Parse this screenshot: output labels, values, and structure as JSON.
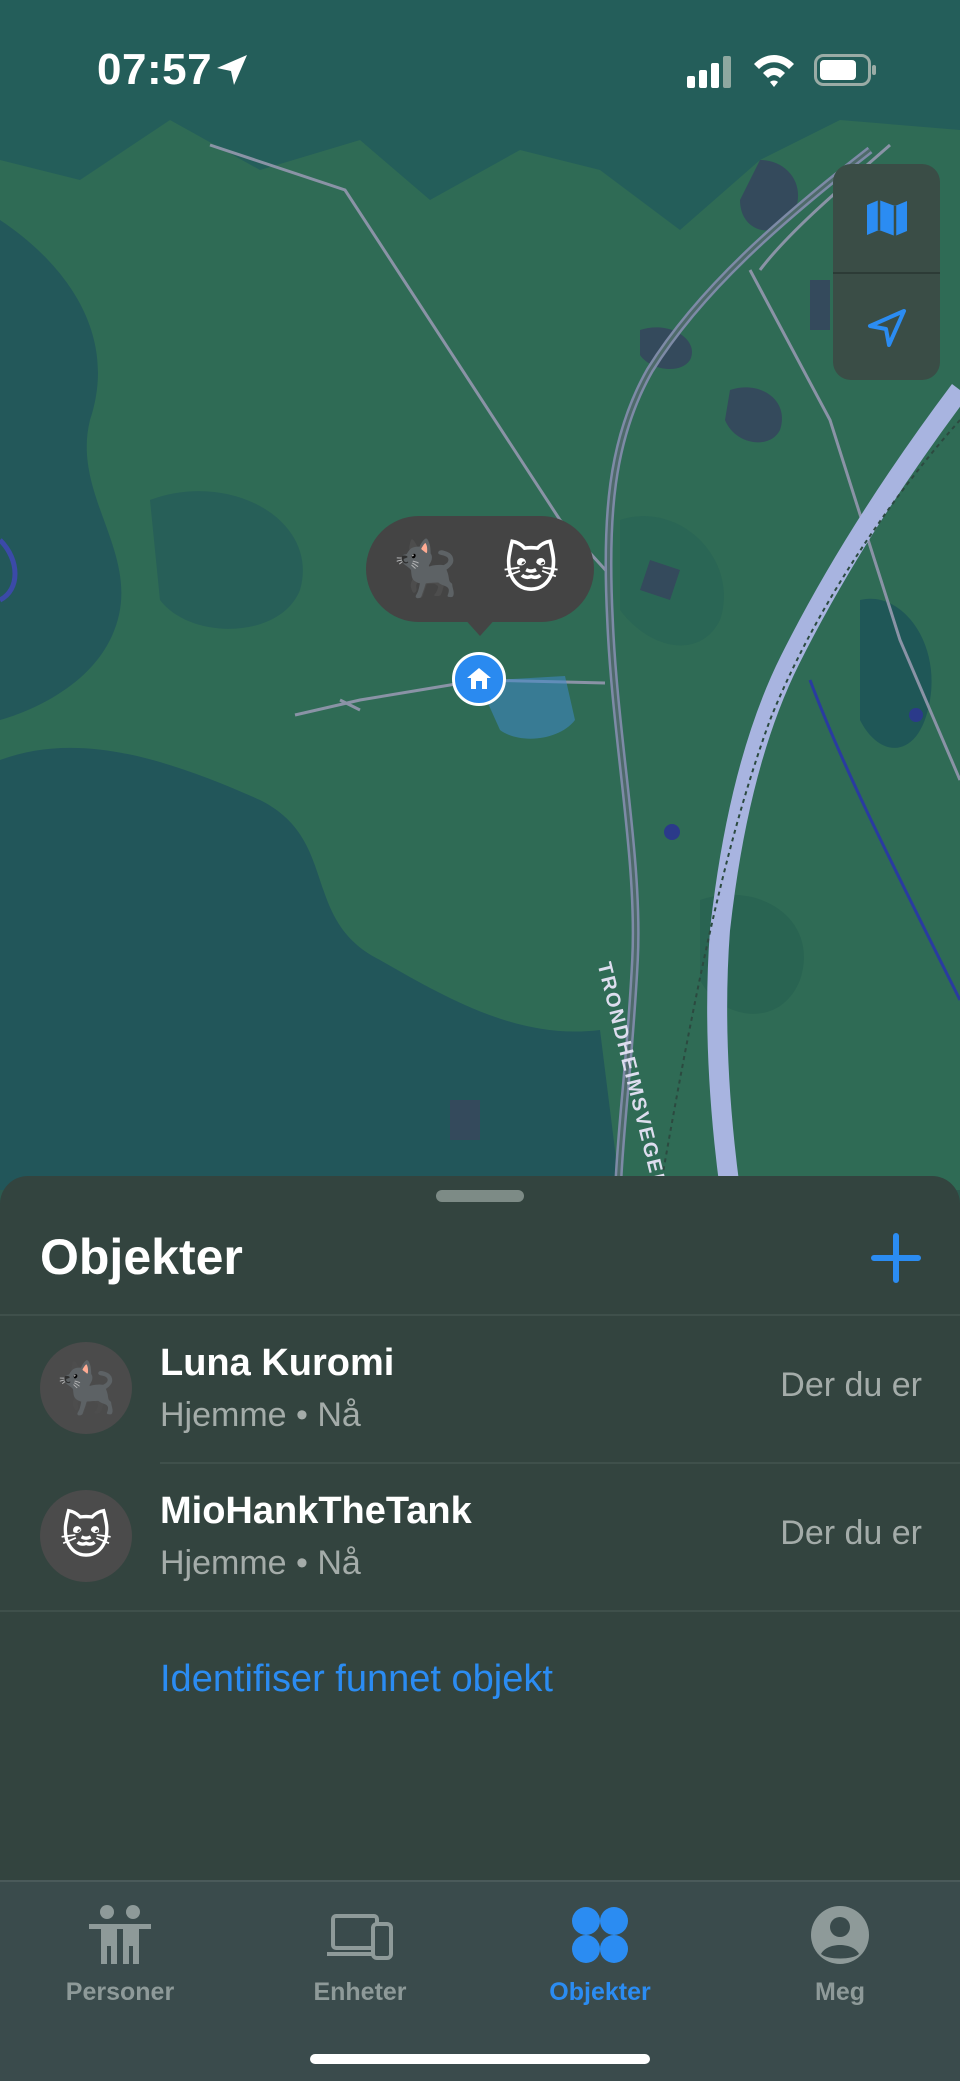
{
  "status": {
    "time": "07:57"
  },
  "map": {
    "road_label": "TRONDHEIMSVEGEN-KLØFTA",
    "callout_pets": [
      "🐈‍⬛",
      "🐱"
    ],
    "controls": [
      "map-icon",
      "location-arrow-icon"
    ]
  },
  "sheet": {
    "title": "Objekter",
    "items": [
      {
        "emoji": "🐈‍⬛",
        "name": "Luna Kuromi",
        "subtitle": "Hjemme • Nå",
        "distance": "Der du er"
      },
      {
        "emoji": "🐱",
        "name": "MioHankTheTank",
        "subtitle": "Hjemme • Nå",
        "distance": "Der du er"
      }
    ],
    "identify_link": "Identifiser funnet objekt"
  },
  "tabs": [
    {
      "label": "Personer",
      "icon": "people-icon",
      "active": false
    },
    {
      "label": "Enheter",
      "icon": "devices-icon",
      "active": false
    },
    {
      "label": "Objekter",
      "icon": "items-icon",
      "active": true
    },
    {
      "label": "Meg",
      "icon": "person-circle-icon",
      "active": false
    }
  ],
  "colors": {
    "accent": "#2b8cf2",
    "sheet": "#33443f",
    "map_green": "#2f6b55"
  }
}
